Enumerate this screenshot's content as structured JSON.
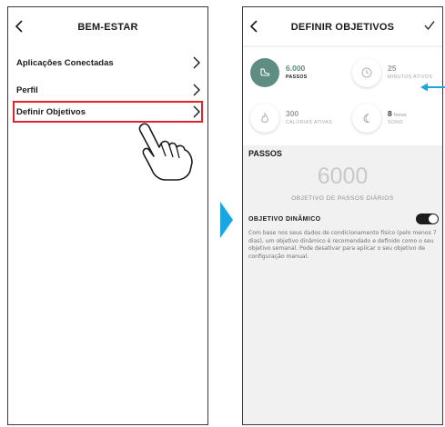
{
  "left_screen": {
    "title": "BEM-ESTAR",
    "items": [
      {
        "label": "Aplicações Conectadas"
      },
      {
        "label": "Perfil"
      },
      {
        "label": "Definir Objetivos"
      }
    ]
  },
  "right_screen": {
    "title": "DEFINIR OBJETIVOS",
    "goals": [
      {
        "value": "6.000",
        "unit": "",
        "label": "PASSOS",
        "icon": "shoe-icon"
      },
      {
        "value": "25",
        "unit": "",
        "label": "MINUTOS ATIVOS",
        "icon": "timer-icon"
      },
      {
        "value": "300",
        "unit": "",
        "label": "CALORIAS ATIVAS",
        "icon": "flame-icon"
      },
      {
        "value": "8",
        "unit": "horas",
        "label": "SONO",
        "icon": "moon-icon"
      }
    ],
    "section_title": "PASSOS",
    "big_value": "6000",
    "big_caption": "OBJETIVO DE PASSOS DIÁRIOS",
    "dynamic": {
      "title": "OBJETIVO DINÂMICO",
      "enabled": true,
      "description": "Com base nos seus dados de condicionamento físico (pelo menos 7 dias), um objetivo dinâmico é recomendado e definido como o seu objetivo semanal. Pode desativar para aplicar o seu objetivo de configuração manual."
    }
  },
  "colors": {
    "highlight_border": "#e0242a",
    "accent_blue": "#1aa6e4",
    "active_goal": "#5f8d82",
    "right_bg": "#f1f1f1"
  }
}
